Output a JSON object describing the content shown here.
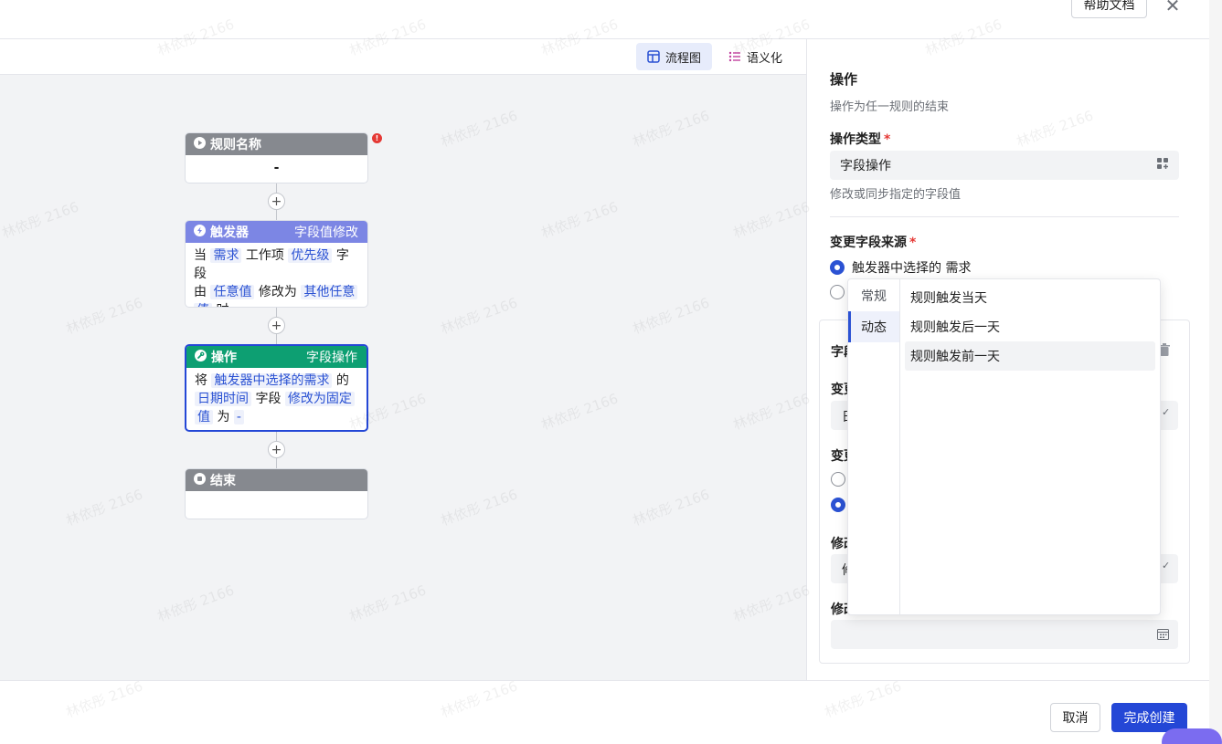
{
  "header": {
    "help_doc_label": "帮助文档"
  },
  "toolbar": {
    "flowchart_label": "流程图",
    "semantic_label": "语义化"
  },
  "flow": {
    "rule_node": {
      "title": "规则名称",
      "body": "-"
    },
    "trigger_node": {
      "title": "触发器",
      "tag": "字段值修改",
      "p1": "当",
      "t1": "需求",
      "p2": "工作项",
      "t2": "优先级",
      "p3": "字段",
      "p4": "由",
      "t3": "任意值",
      "p5": "修改为",
      "t4": "其他任意",
      "t5": "值",
      "p6": "时"
    },
    "action_node": {
      "title": "操作",
      "tag": "字段操作",
      "p1": "将",
      "t1": "触发器中选择的需求",
      "p2": "的",
      "t2": "日期时间",
      "p3": "字段",
      "t3": "修改为固定",
      "t4": "值",
      "p4": "为",
      "t5": "-"
    },
    "end_node": {
      "title": "结束"
    },
    "plus_label": "+",
    "error_mark": "!"
  },
  "panel": {
    "title": "操作",
    "desc": "操作为任一规则的结束",
    "op_type_label": "操作类型",
    "op_type_value": "字段操作",
    "op_type_hint": "修改或同步指定的字段值",
    "source_label": "变更字段来源",
    "source_option1": "触发器中选择的 需求",
    "required_mark": "*",
    "sub": {
      "l1": "字段",
      "l2": "变更",
      "f1": "日",
      "l3": "变更",
      "l4": "修改",
      "f2": "修",
      "l5": "修改"
    }
  },
  "popup": {
    "tabs": [
      "常规",
      "动态"
    ],
    "items": [
      "规则触发当天",
      "规则触发后一天",
      "规则触发前一天"
    ]
  },
  "footer": {
    "cancel_label": "取消",
    "finish_label": "完成创建"
  },
  "watermark_text": "林依彤 2166",
  "colors": {
    "primary": "#2447d6",
    "trigger": "#7c86e4",
    "action": "#0d9f72",
    "node_gray": "#86898f"
  }
}
